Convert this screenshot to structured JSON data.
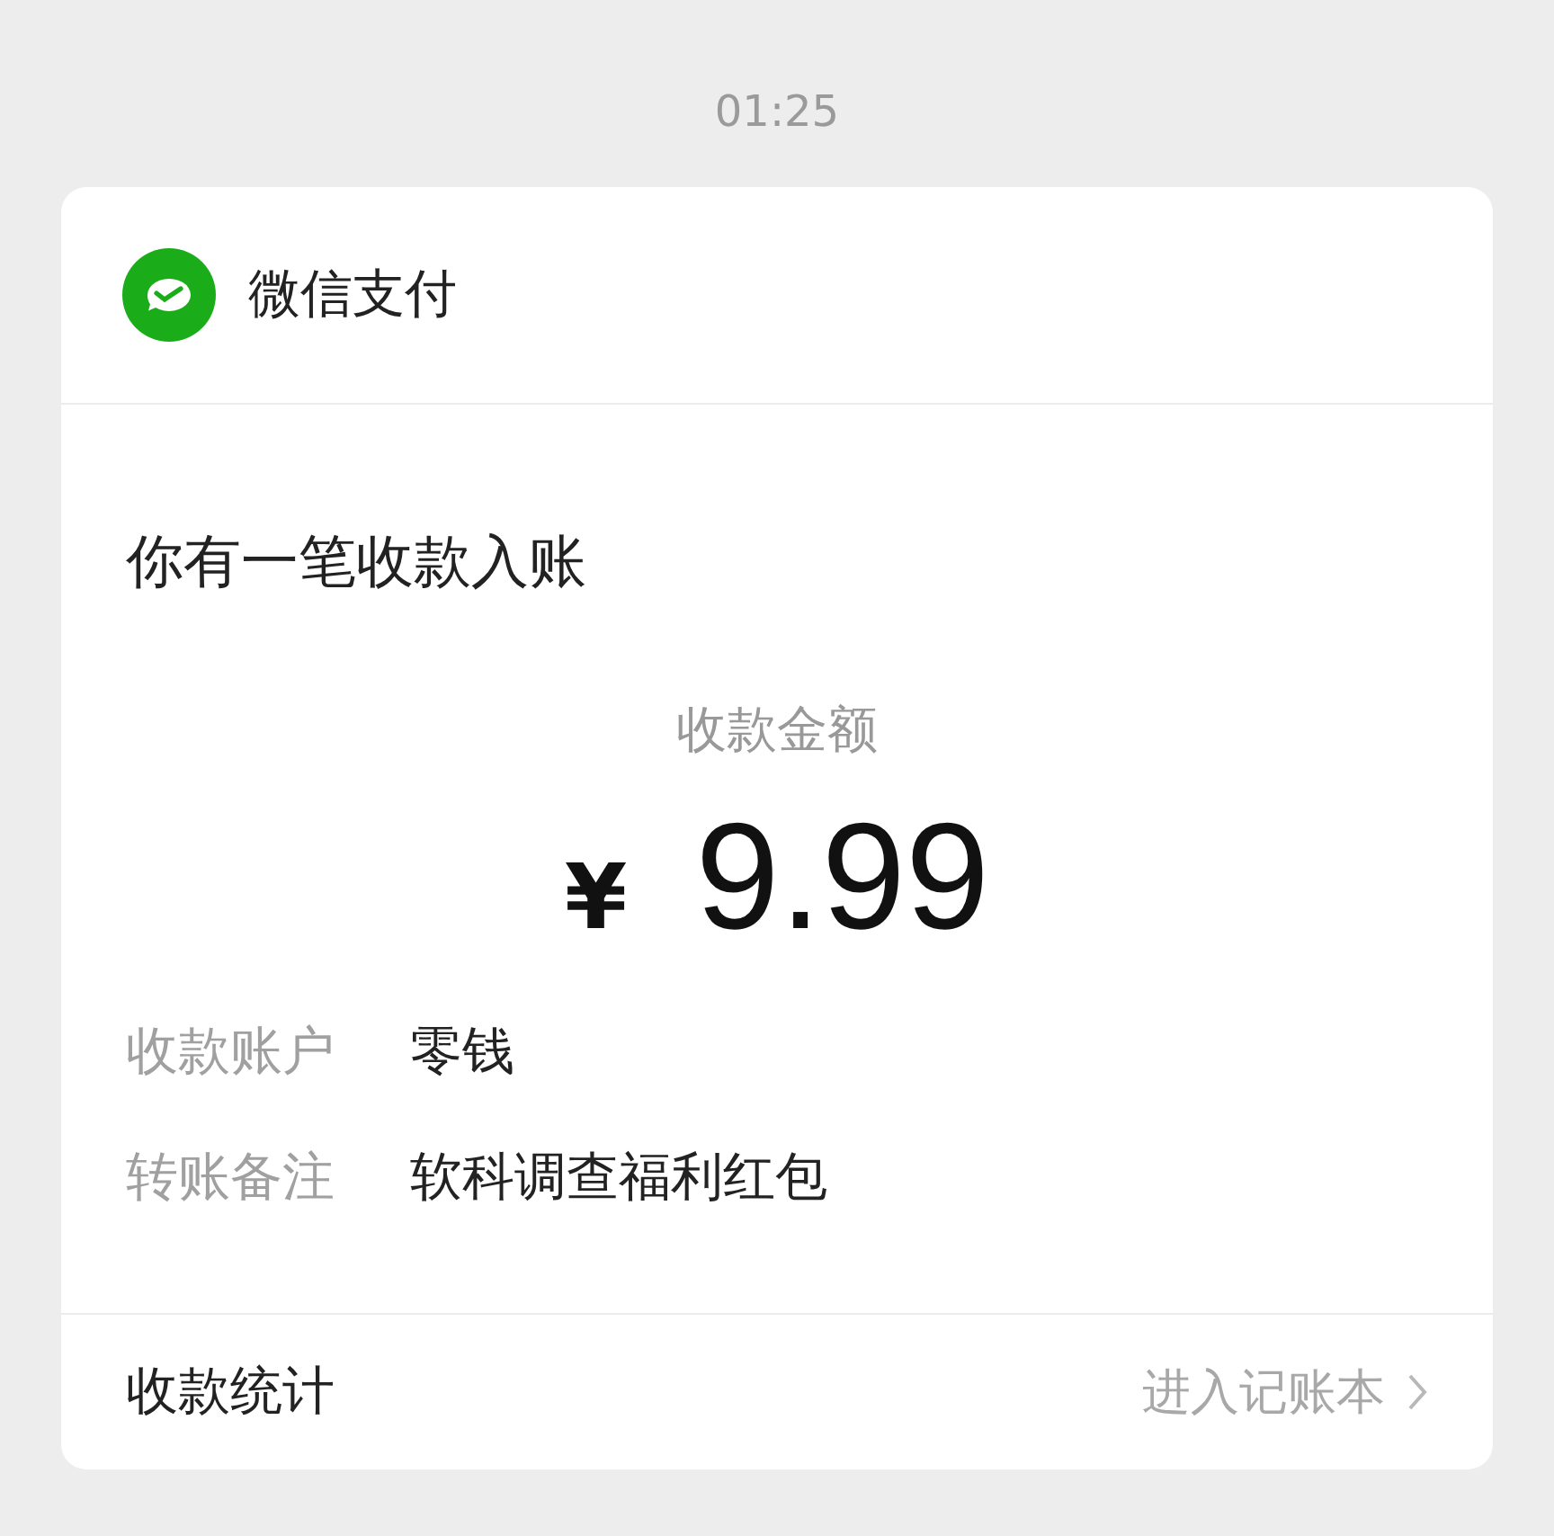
{
  "time": "01:25",
  "card": {
    "app_name": "微信支付",
    "headline": "你有一笔收款入账",
    "amount_label": "收款金额",
    "currency": "¥",
    "amount": "9.99",
    "fields": [
      {
        "label": "收款账户",
        "value": "零钱"
      },
      {
        "label": "转账备注",
        "value": "软科调查福利红包"
      }
    ],
    "footer": {
      "label": "收款统计",
      "link": "进入记账本"
    }
  }
}
